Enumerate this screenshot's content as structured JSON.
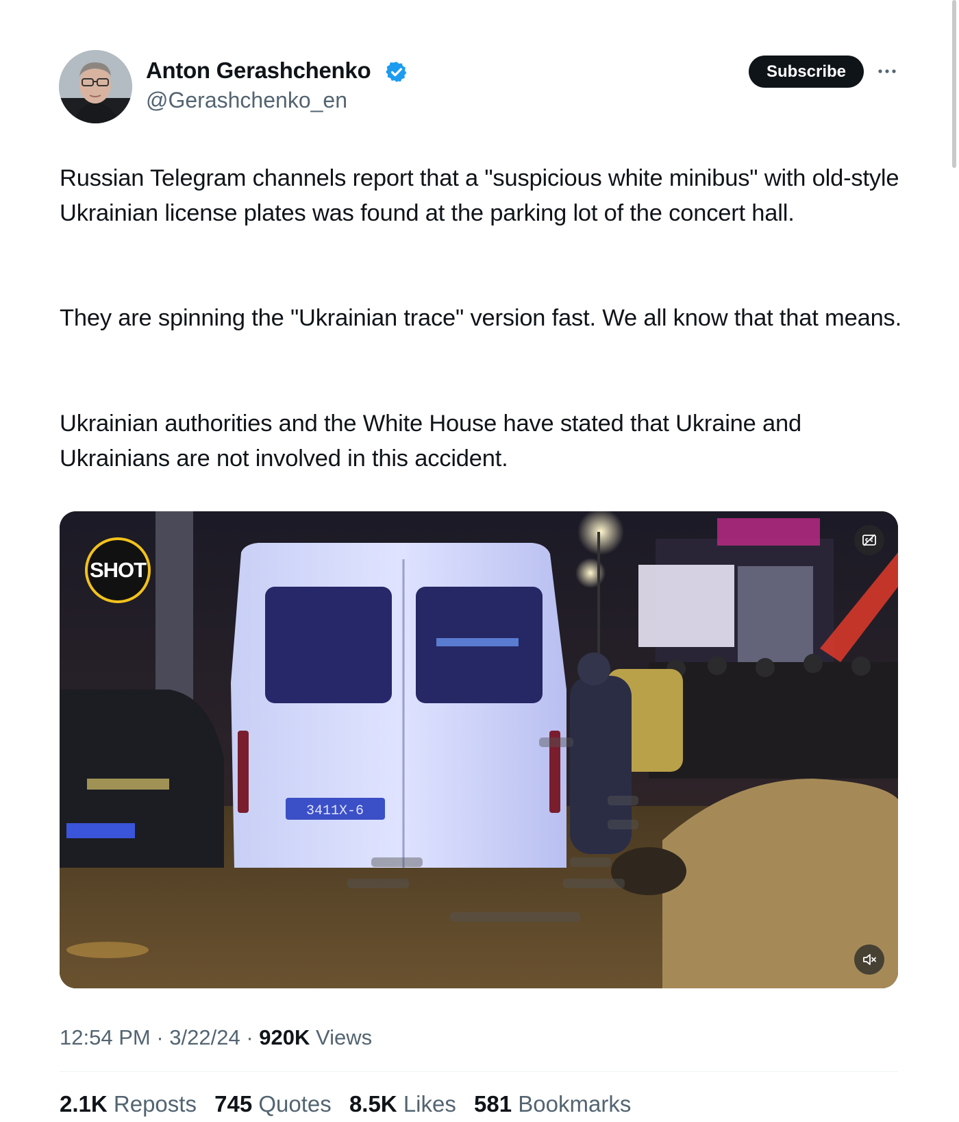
{
  "author": {
    "name": "Anton Gerashchenko",
    "handle": "@Gerashchenko_en"
  },
  "subscribe_label": "Subscribe",
  "tweet": {
    "paragraphs": [
      "Russian Telegram channels report that a \"suspicious white minibus\" with old-style Ukrainian license plates was found at the parking lot of the concert hall.",
      "They are spinning the \"Ukrainian trace\" version fast. We all know that that means.",
      "Ukrainian authorities and the White House have stated that Ukraine and Ukrainians are not involved in this accident."
    ]
  },
  "media": {
    "watermark": "SHOT",
    "plate_text": "3411X-6"
  },
  "meta": {
    "time": "12:54 PM",
    "date": "3/22/24",
    "views_count": "920K",
    "views_label": "Views"
  },
  "stats": [
    {
      "count": "2.1K",
      "label": "Reposts"
    },
    {
      "count": "745",
      "label": "Quotes"
    },
    {
      "count": "8.5K",
      "label": "Likes"
    },
    {
      "count": "581",
      "label": "Bookmarks"
    }
  ],
  "colors": {
    "text_primary": "#0f1419",
    "text_secondary": "#536471",
    "verified_blue": "#1d9bf0",
    "button_dark": "#0f1419",
    "watermark_ring": "#f2c21b"
  }
}
